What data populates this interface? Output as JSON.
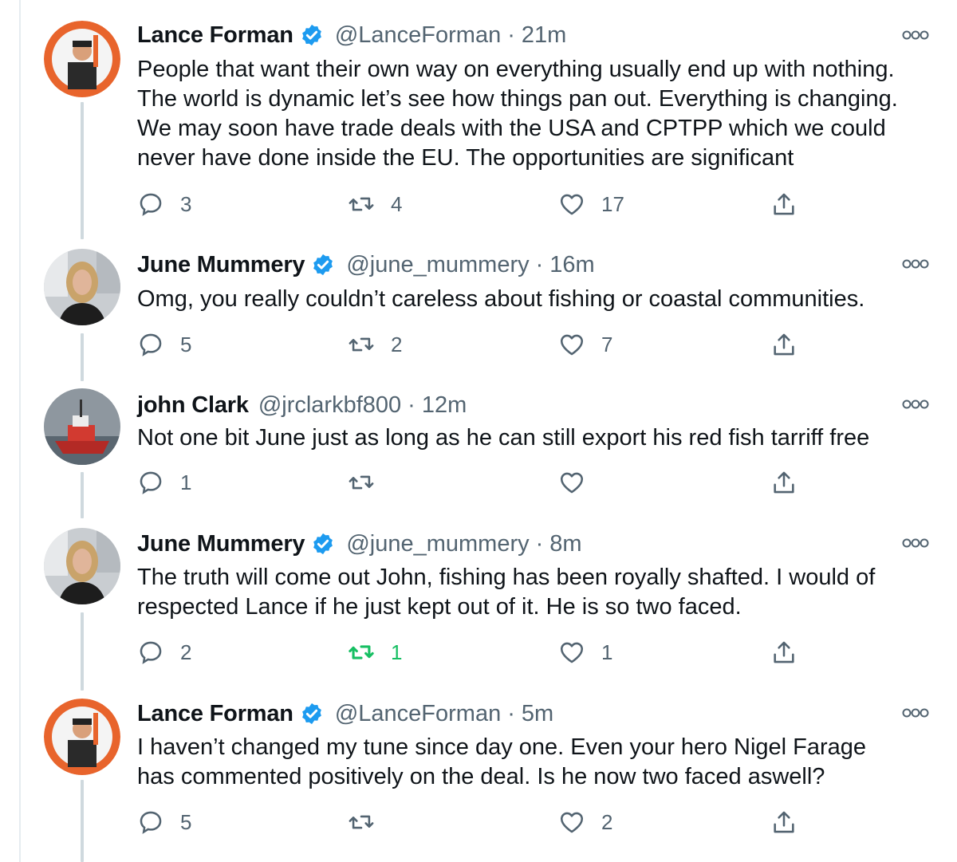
{
  "tweets": [
    {
      "name": "Lance Forman",
      "handle": "@LanceForman",
      "time": "21m",
      "text": "People that want their own way on everything usually end up with nothing.\nThe world is dynamic let’s see how things pan out. Everything is changing.\nWe may soon have trade deals with the USA and CPTPP which we could\nnever have done inside the EU. The opportunities are significant",
      "replies": "3",
      "retweets": "4",
      "likes": "17",
      "retweet_active": false,
      "verified": true
    },
    {
      "name": "June Mummery",
      "handle": "@june_mummery",
      "time": "16m",
      "text": "Omg, you really couldn’t careless about fishing or coastal communities.",
      "replies": "5",
      "retweets": "2",
      "likes": "7",
      "retweet_active": false,
      "verified": true
    },
    {
      "name": "john Clark",
      "handle": "@jrclarkbf800",
      "time": "12m",
      "text": "Not one bit June just as long as he can still export his red fish tarriff free",
      "replies": "1",
      "retweets": "",
      "likes": "",
      "retweet_active": false,
      "verified": false
    },
    {
      "name": "June Mummery",
      "handle": "@june_mummery",
      "time": "8m",
      "text": "The truth will come out John, fishing has been royally shafted. I would of\nrespected Lance if he just kept out of it. He is so two faced.",
      "replies": "2",
      "retweets": "1",
      "likes": "1",
      "retweet_active": true,
      "verified": true
    },
    {
      "name": "Lance Forman",
      "handle": "@LanceForman",
      "time": "5m",
      "text": "I haven’t changed my tune since day one.  Even your hero Nigel Farage\nhas commented positively on the deal. Is he now two faced aswell?",
      "replies": "5",
      "retweets": "",
      "likes": "2",
      "retweet_active": false,
      "verified": true
    }
  ],
  "separator": "·",
  "colors": {
    "text": "#0f1419",
    "secondary": "#536471",
    "verified": "#1d9bf0",
    "retweet_active": "#17bf63",
    "thread_line": "#cfd9de"
  },
  "icons": {
    "verified": "verified-badge-icon",
    "more": "more-options-icon",
    "reply": "reply-icon",
    "retweet": "retweet-icon",
    "like": "like-heart-icon",
    "share": "share-icon"
  }
}
